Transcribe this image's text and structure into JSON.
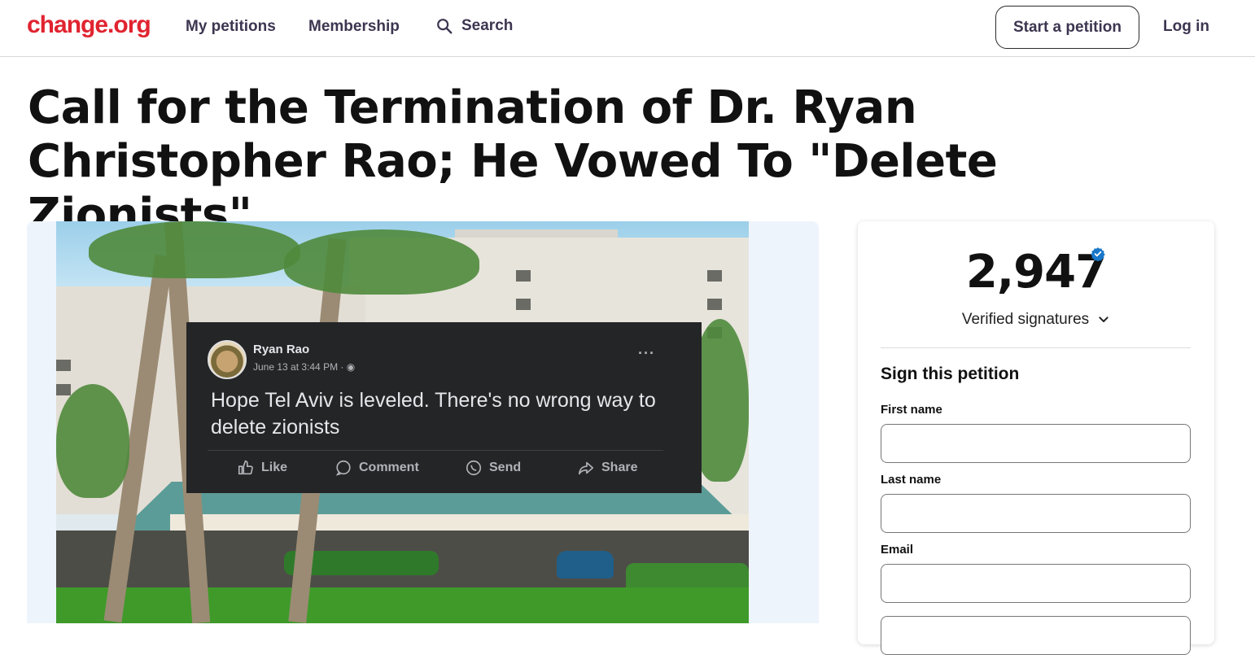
{
  "header": {
    "logo": "change.org",
    "nav": {
      "my_petitions": "My petitions",
      "membership": "Membership",
      "search": "Search"
    },
    "start_petition": "Start a petition",
    "log_in": "Log in",
    "brand_color": "#e02430"
  },
  "petition": {
    "title": "Call for the Termination of Dr. Ryan Christopher Rao; He Vowed To \"Delete Zionists\""
  },
  "media": {
    "post": {
      "author": "Ryan Rao",
      "timestamp": "June 13 at 3:44 PM · ",
      "text": "Hope Tel Aviv is leveled. There's no wrong way to delete zionists",
      "more": "···",
      "actions": {
        "like": "Like",
        "comment": "Comment",
        "send": "Send",
        "share": "Share"
      }
    }
  },
  "signatures": {
    "count": "2,947",
    "label": "Verified signatures",
    "verified_color": "#1877c9"
  },
  "form": {
    "title": "Sign this petition",
    "first_name_label": "First name",
    "last_name_label": "Last name",
    "email_label": "Email"
  }
}
